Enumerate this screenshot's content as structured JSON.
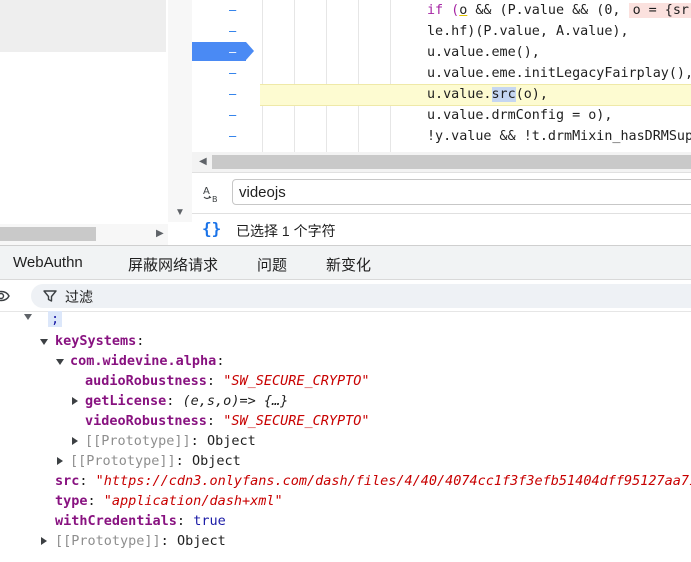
{
  "code": {
    "gutter_markers": [
      "–",
      "–",
      "–",
      "–",
      "–",
      "–",
      "–"
    ],
    "lines": [
      {
        "prefix": "if (",
        "p1": "o",
        "mid": " && (P.value && (0, ",
        "badge": "o = {sr"
      },
      {
        "text": "le.hf)(P.value, A.value),"
      },
      {
        "text": "u.value.eme(),"
      },
      {
        "text": "u.value.eme.initLegacyFairplay(),"
      },
      {
        "pre": "u.value.",
        "hl": "src",
        "post": "(o),"
      },
      {
        "text": "u.value.drmConfig = o),"
      },
      {
        "text": "!y.value && !t.drmMixin_hasDRMSup"
      }
    ]
  },
  "search": {
    "value": "videojs"
  },
  "status": {
    "text": "已选择 1 个字符"
  },
  "drawer_tabs": [
    "WebAuthn",
    "屏蔽网络请求",
    "问题",
    "新变化"
  ],
  "filter": {
    "label": "过滤"
  },
  "tree": {
    "top_snippet": ";",
    "key_systems_key": "keySystems",
    "widevine_key": "com.widevine.alpha",
    "audio_key": "audioRobustness",
    "audio_val": "\"SW_SECURE_CRYPTO\"",
    "license_key": "getLicense",
    "license_val": "(e,s,o)=> {…}",
    "video_key": "videoRobustness",
    "video_val": "\"SW_SECURE_CRYPTO\"",
    "proto_label": "[[Prototype]]",
    "object_label": "Object",
    "src_key": "src",
    "src_val": "\"https://cdn3.onlyfans.com/dash/files/4/40/4074cc1f3f3efb51404dff95127aa71",
    "type_key": "type",
    "type_val": "\"application/dash+xml\"",
    "cred_key": "withCredentials",
    "cred_val": "true"
  },
  "colors": {
    "accent": "#1a73e8",
    "breakpoint": "#4a8af4",
    "exec_line": "#fdfbd1",
    "key": "#881280",
    "string": "#c80000"
  }
}
